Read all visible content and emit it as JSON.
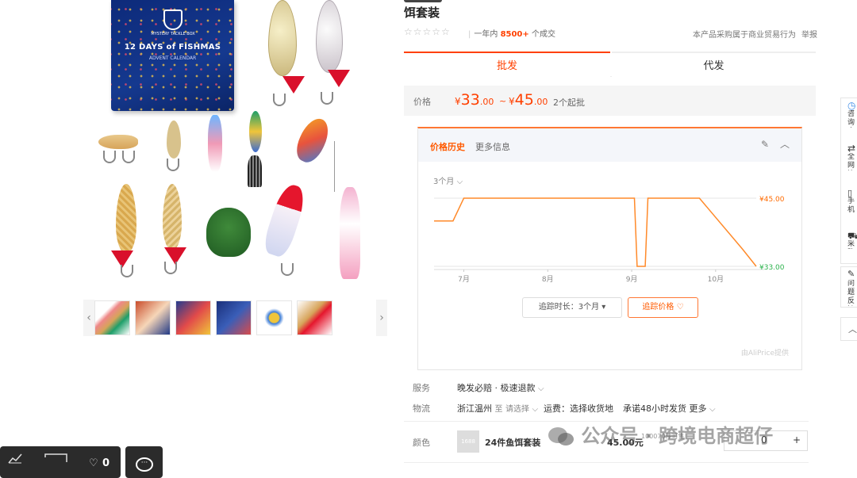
{
  "product": {
    "title_suffix": "饵套装",
    "box_brand": "MYSTERY TACKLE BOX",
    "box_title": "12 DAYS of FISHMAS",
    "box_subtitle": "ADVENT CALENDAR",
    "rating_stars": "☆☆☆☆☆",
    "sales_prefix": "一年内",
    "sales_count": "8500+",
    "sales_suffix": "个成交",
    "compliance": "本产品采购属于商业贸易行为",
    "report": "举报"
  },
  "tabs": {
    "wholesale": "批发",
    "dropship": "代发"
  },
  "price": {
    "label": "价格",
    "currency": "¥",
    "min_int": "33",
    "min_dec": ".00",
    "max_int": "45",
    "max_dec": ".00",
    "range_sep": "~",
    "moq": "2个起批"
  },
  "price_history": {
    "tab_history": "价格历史",
    "tab_more": "更多信息",
    "range": "3个月",
    "high_label": "¥45.00",
    "low_label": "¥33.00",
    "track_duration": "追踪时长：3个月",
    "track_price": "追踪价格",
    "credit": "由AliPrice提供",
    "chart_colors": {
      "line": "#ff8a2a",
      "high": "#ff6a00",
      "low": "#2bb24c"
    }
  },
  "chart_data": {
    "type": "line",
    "x_ticks": [
      "7月",
      "8月",
      "9月",
      "10月"
    ],
    "series": [
      {
        "x": [
          "06-25",
          "07-01",
          "07-05",
          "08-01",
          "09-01",
          "09-06",
          "09-07",
          "09-10",
          "09-11",
          "09-20",
          "09-30",
          "10-15",
          "10-20"
        ],
        "values": [
          41,
          41,
          45,
          45,
          45,
          45,
          33,
          33,
          45,
          45,
          45,
          36,
          33
        ]
      }
    ],
    "ylim": [
      33,
      45
    ]
  },
  "service": {
    "service_label": "服务",
    "service_value": "晚发必赔 · 极速退款",
    "logistics_label": "物流",
    "logistics_origin": "浙江温州",
    "logistics_to": "至",
    "logistics_choose": "请选择",
    "shipping": "运费：选择收货地",
    "promise": "承诺48小时发货",
    "more": "更多"
  },
  "variant": {
    "color_label": "颜色",
    "thumb_text": "1688",
    "name": "24件鱼饵套装",
    "price": "45.00元",
    "stock": "100070件可售",
    "qty": "0"
  },
  "sidebar": {
    "consult": "咨询客服",
    "compare": "全网比价",
    "mobile": "手机下单",
    "cart": "采购车",
    "feedback": "问题反馈"
  },
  "float": {
    "likes": "0"
  },
  "watermark": "公众号 · 跨境电商超仔"
}
